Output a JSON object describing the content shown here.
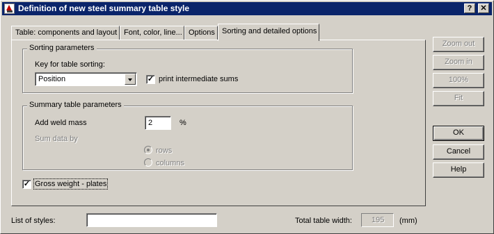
{
  "window": {
    "title": "Definition of new steel summary table style",
    "help_glyph": "?",
    "close_glyph": "✕"
  },
  "tabs": [
    {
      "label": "Table: components and layout"
    },
    {
      "label": "Font, color, line..."
    },
    {
      "label": "Options"
    },
    {
      "label": "Sorting and detailed options",
      "active": true
    }
  ],
  "sorting": {
    "group_label": "Sorting parameters",
    "key_label": "Key for table sorting:",
    "key_value": "Position",
    "intermediate_checked": true,
    "intermediate_label": "print intermediate sums"
  },
  "summary": {
    "group_label": "Summary table parameters",
    "weld_label": "Add weld mass",
    "weld_value": "2",
    "weld_unit": "%",
    "sum_by_label": "Sum data by",
    "options": [
      {
        "label": "rows",
        "selected": true
      },
      {
        "label": "columns",
        "selected": false
      }
    ]
  },
  "gross": {
    "checked": true,
    "label": "Gross weight - plates"
  },
  "side_buttons": {
    "zoom_out": "Zoom out",
    "zoom_in": "Zoom in",
    "hundred": "100%",
    "fit": "Fit",
    "ok": "OK",
    "cancel": "Cancel",
    "help": "Help"
  },
  "footer": {
    "styles_label": "List of styles:",
    "styles_value": "",
    "width_label": "Total table width:",
    "width_value": "195",
    "width_unit": "(mm)"
  },
  "check_glyph": "✓"
}
